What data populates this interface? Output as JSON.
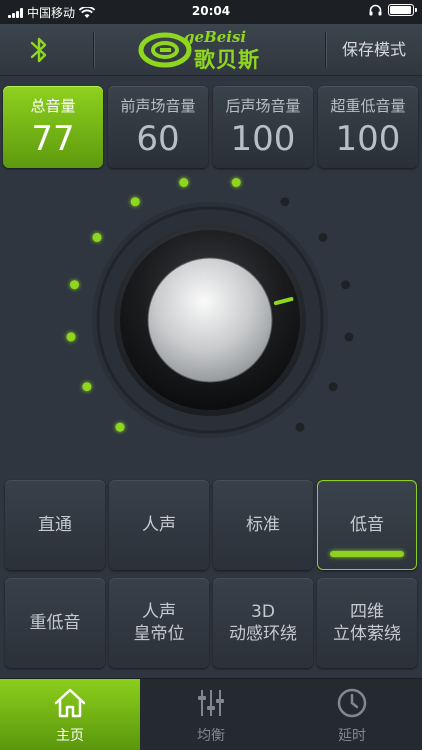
{
  "status_bar": {
    "carrier": "中国移动",
    "time": "20:04",
    "battery_level": 0.95
  },
  "header": {
    "bluetooth_icon": "bluetooth-icon",
    "logo_sub": "geBeisi",
    "logo_main": "歌贝斯",
    "save_mode_label": "保存模式"
  },
  "volumes": [
    {
      "label": "总音量",
      "value": "77",
      "active": true
    },
    {
      "label": "前声场音量",
      "value": "60",
      "active": false
    },
    {
      "label": "后声场音量",
      "value": "100",
      "active": false
    },
    {
      "label": "超重低音量",
      "value": "100",
      "active": false
    }
  ],
  "knob": {
    "level_fraction": 0.77,
    "lit_dots": 8,
    "total_dots": 14,
    "accent_color": "#8fd61e",
    "dot_off_color": "#1e2227"
  },
  "modes": [
    {
      "label": "直通",
      "active": false
    },
    {
      "label": "人声",
      "active": false
    },
    {
      "label": "标准",
      "active": false
    },
    {
      "label": "低音",
      "active": true
    },
    {
      "label": "重低音",
      "active": false
    },
    {
      "label": "人声\n皇帝位",
      "active": false
    },
    {
      "label": "3D\n动感环绕",
      "active": false
    },
    {
      "label": "四维\n立体萦绕",
      "active": false
    }
  ],
  "nav": [
    {
      "label": "主页",
      "icon": "home-icon",
      "active": true
    },
    {
      "label": "均衡",
      "icon": "equalizer-icon",
      "active": false
    },
    {
      "label": "延时",
      "icon": "clock-icon",
      "active": false
    }
  ],
  "colors": {
    "accent": "#8fd61e",
    "background": "#2f3640"
  }
}
